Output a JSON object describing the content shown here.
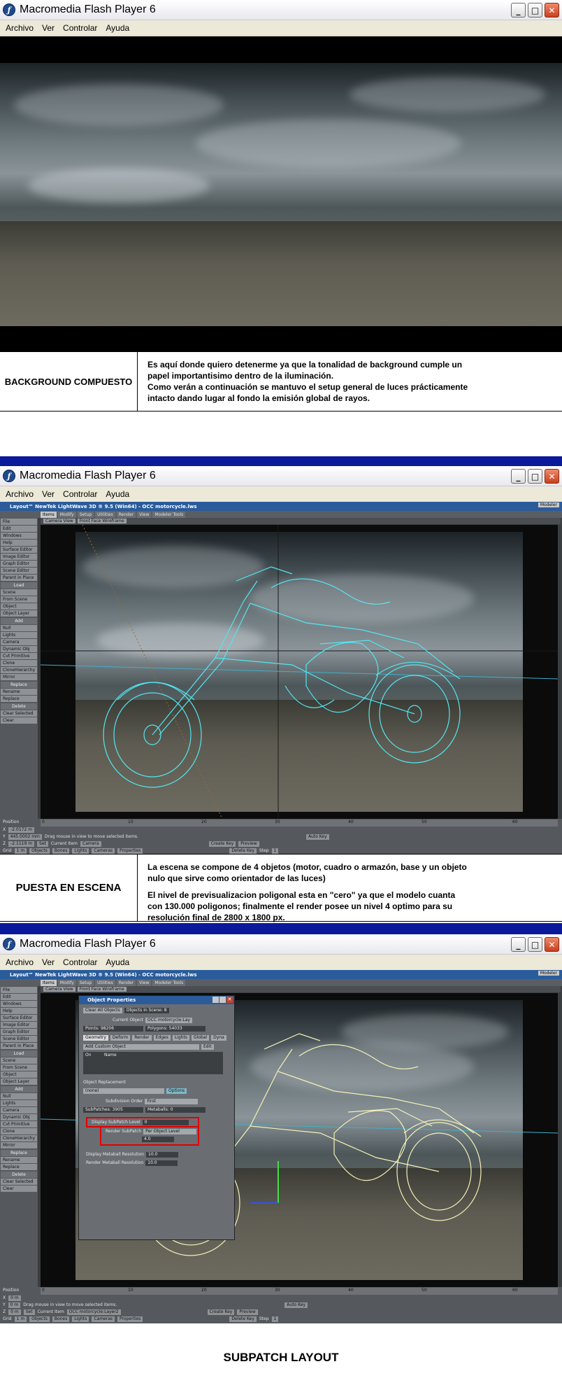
{
  "window": {
    "title": "Macromedia Flash Player 6",
    "icon": "flash-player-icon",
    "menu": [
      "Archivo",
      "Ver",
      "Controlar",
      "Ayuda"
    ]
  },
  "panel1": {
    "caption_label": "BACKGROUND COMPUESTO",
    "caption_lines": [
      "Es aquí donde quiero detenerme ya que la tonalidad de background cumple un",
      "papel importantisimo dentro de la iluminación.",
      "Como verán a continuación se mantuvo el setup general de luces prácticamente",
      "intacto dando lugar al fondo la emisión global de rayos."
    ]
  },
  "panel2": {
    "caption_label": "PUESTA EN ESCENA",
    "caption_lines": [
      "La escena se compone de 4 objetos (motor, cuadro o armazón, base y un objeto",
      "nulo que sirve como orientador de las luces)",
      "",
      "El nivel de previsualizacion poligonal esta en \"cero\" ya que el modelo cuanta",
      "con 130.000 poligonos; finalmente el render posee un nivel 4 optimo para su",
      "resolución final de 2800 x 1800 px."
    ]
  },
  "panel3": {
    "caption_label": "SUBPATCH LAYOUT"
  },
  "lightwave": {
    "title": "Layout™ NewTek LightWave 3D ® 9.5  (Win64) - OCC motorcycle.lws",
    "modeler_btn": "Modeler",
    "tabs": [
      "Items",
      "Modify",
      "Setup",
      "Utilities",
      "Render",
      "View",
      "Modeler Tools"
    ],
    "view_camera": "Camera View",
    "view_mode": "Front Face Wireframe",
    "side_top": [
      "File",
      "Edit",
      "Windows",
      "Help",
      "Surface Editor",
      "Image Editor",
      "Graph Editor",
      "Scene Editor",
      "Parent in Place"
    ],
    "side_load_head": "Load",
    "side_load": [
      "Scene",
      "From Scene",
      "Object",
      "Object Layer"
    ],
    "side_add_head": "Add",
    "side_add": [
      "Null",
      "Lights",
      "Camera",
      "Dynamic Obj",
      "Cvt Primitive",
      "Clone",
      "CloneHierarchy",
      "Mirror"
    ],
    "side_replace_head": "Replace",
    "side_replace": [
      "Rename",
      "Replace"
    ],
    "side_delete_head": "Delete",
    "side_delete": [
      "Clear Selected",
      "Clear"
    ],
    "position_label": "Position",
    "x_label": "X",
    "y_label": "Y",
    "z_label": "Z",
    "grid_label": "Grid",
    "x_value": "-2.0172 m",
    "y_value": "445.0002 mm",
    "z_value": "-2.1119 m",
    "grid_value": "1 m",
    "status_msg": "Drag mouse in view to move selected items.",
    "set_btn": "Set",
    "current_item_label": "Current Item",
    "current_item": "Camera",
    "tabs_bottom": [
      "Objects",
      "Bones",
      "Lights",
      "Cameras",
      "Properties"
    ],
    "auto_key": "Auto Key",
    "create_key": "Create Key",
    "delete_key": "Delete Key",
    "preview": "Preview",
    "step": "Step",
    "step_value": "1",
    "timeline_ticks": [
      "0",
      "10",
      "20",
      "30",
      "40",
      "50",
      "60"
    ],
    "frame_end": "60"
  },
  "lightwave3": {
    "x_value": "0 m",
    "y_value": "0 m",
    "z_value": "0 m",
    "grid_value": "1 m",
    "current_item": "OCC motorcycle:Layer2"
  },
  "object_properties": {
    "title": "Object Properties",
    "clear_all": "Clear All Objects",
    "objects_in_scene": "Objects in Scene: 8",
    "current_object_label": "Current Object",
    "current_object": "OCC motorcycle:Lay",
    "points": "Points: 98206",
    "polygons": "Polygons: 54033",
    "tabs": [
      "Geometry",
      "Deform",
      "Render",
      "Edges",
      "Lights",
      "Global",
      "Dyna"
    ],
    "add_custom_object": "Add Custom Object",
    "edit": "Edit",
    "col_on": "On",
    "col_name": "Name",
    "object_replacement": "Object Replacement",
    "replacement_value": "(none)",
    "options": "Options",
    "subdivision_order_label": "Subdivision Order",
    "subdivision_order": "First",
    "subpatches": "SubPatches: 3905",
    "metaballs": "Metaballs: 0",
    "display_subpatch_label": "Display SubPatch Level",
    "display_subpatch": "0",
    "render_subpatch_label": "Render SubPatch",
    "render_subpatch": "Per Object Level",
    "render_level": "4.0",
    "display_metaball_label": "Display Metaball Resolution",
    "display_metaball": "10.0",
    "render_metaball_label": "Render Metaball Resolution",
    "render_metaball": "10.0"
  },
  "colors": {
    "blue_separator": "#0b1a9a",
    "wireframe_cyan": "#52e6f0",
    "wireframe_cream": "#f4f0b8",
    "highlight_red": "#e00000",
    "lw_titlebar": "#2a5c9c"
  }
}
